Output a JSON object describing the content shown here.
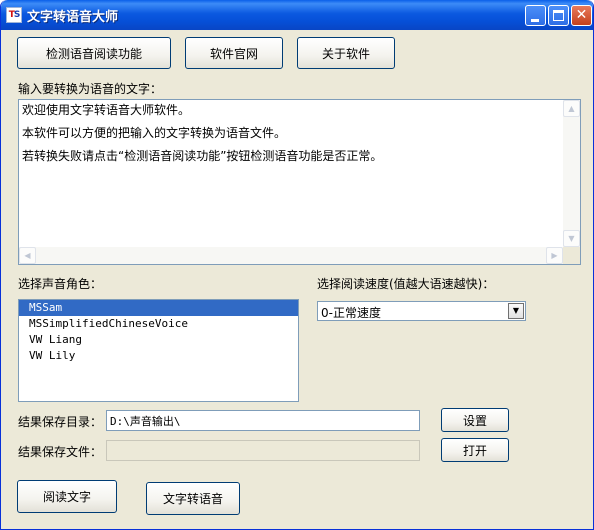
{
  "window": {
    "title": "文字转语音大师",
    "icon_text_t": "T",
    "icon_text_s": "S",
    "minimize_glyph": "minimize-icon",
    "maximize_glyph": "maximize-icon",
    "close_glyph": "✕"
  },
  "toolbar": {
    "detect_label": "检测语音阅读功能",
    "website_label": "软件官网",
    "about_label": "关于软件"
  },
  "text_input": {
    "label": "输入要转换为语音的文字：",
    "lines": [
      "欢迎使用文字转语音大师软件。",
      "本软件可以方便的把输入的文字转换为语音文件。",
      "若转换失败请点击“检测语音阅读功能”按钮检测语音功能是否正常。"
    ]
  },
  "voice": {
    "label": "选择声音角色：",
    "items": [
      "MSSam",
      "MSSimplifiedChineseVoice",
      "VW Liang",
      "VW Lily"
    ],
    "selected_index": 0
  },
  "speed": {
    "label": "选择阅读速度(值越大语速越快)：",
    "selected": "0-正常速度"
  },
  "output": {
    "dir_label": "结果保存目录：",
    "dir_value": "D:\\声音输出\\",
    "file_label": "结果保存文件：",
    "file_value": "",
    "settings_label": "设置",
    "open_label": "打开"
  },
  "actions": {
    "read_label": "阅读文字",
    "convert_label": "文字转语音"
  },
  "colors": {
    "title_bar": "#0650d8",
    "face": "#ece9d8",
    "selection": "#316ac5",
    "close_button": "#c4401c"
  }
}
